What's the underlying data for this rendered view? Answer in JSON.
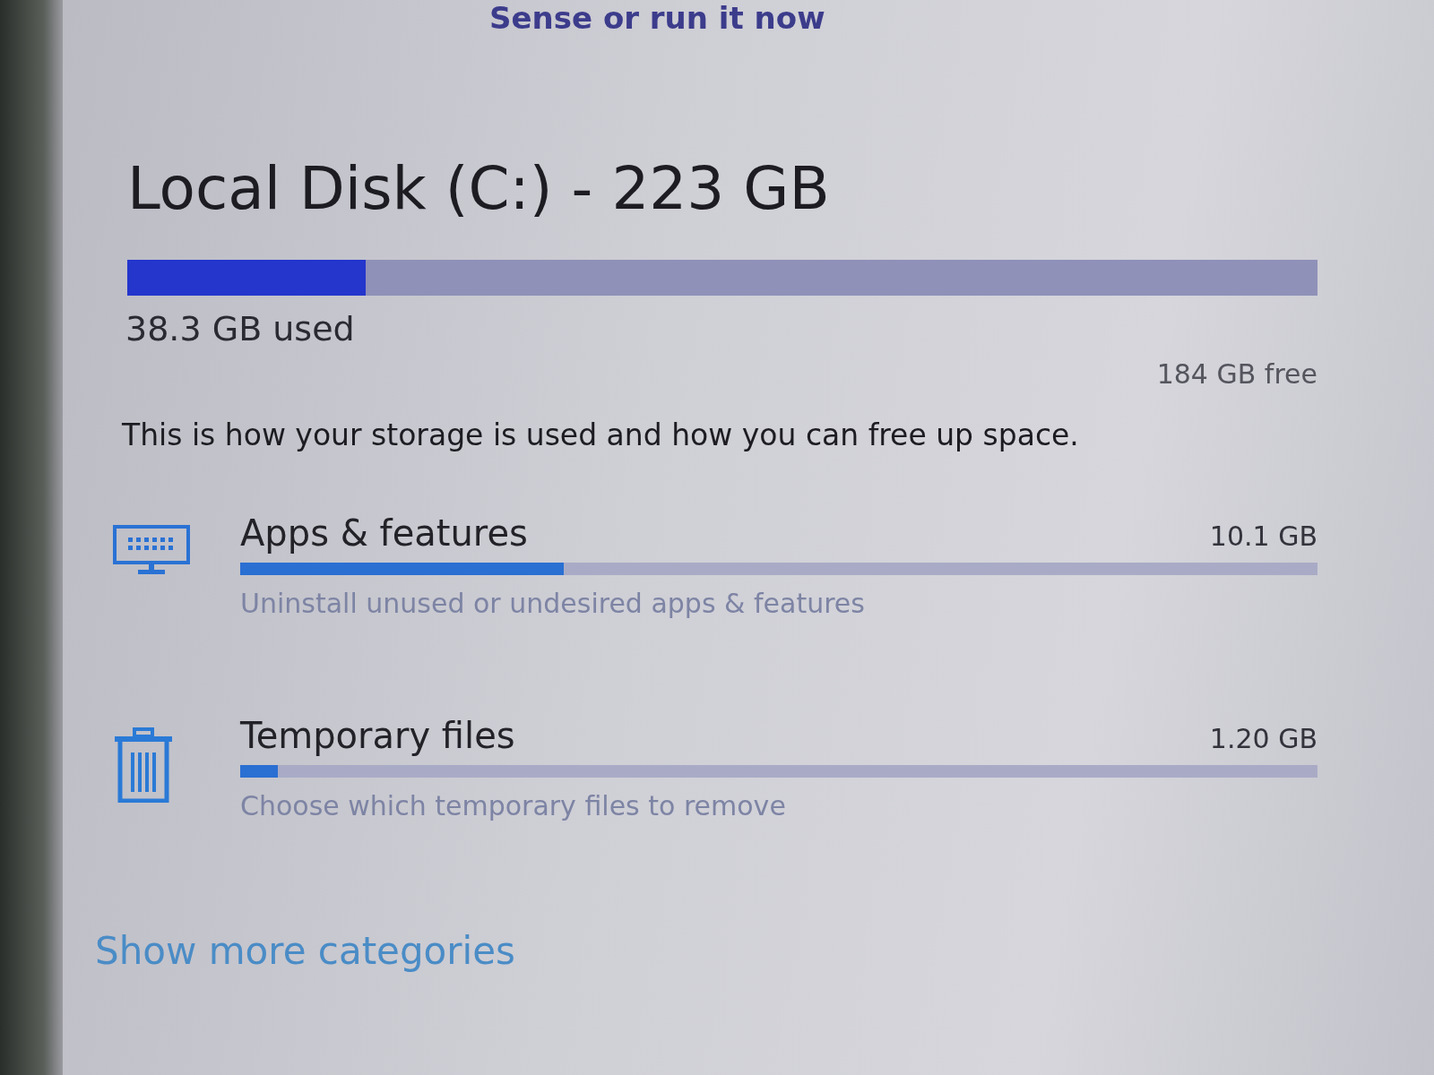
{
  "top_link": {
    "text": "Sense or run it now"
  },
  "drive": {
    "title": "Local Disk (C:) - 223 GB",
    "level": 0.2,
    "used": "38.3 GB used",
    "free": "184 GB free"
  },
  "description": "This is how your storage is used and how you can free up space.",
  "categories": [
    {
      "kind": "apps",
      "name": "Apps & features",
      "size": "10.1 GB",
      "level": 0.3,
      "hint": "Uninstall unused or undesired apps & features"
    },
    {
      "kind": "temp",
      "name": "Temporary files",
      "size": "1.20 GB",
      "level": 0.035,
      "hint": "Choose which temporary files to remove"
    }
  ],
  "show_more": "Show more categories"
}
